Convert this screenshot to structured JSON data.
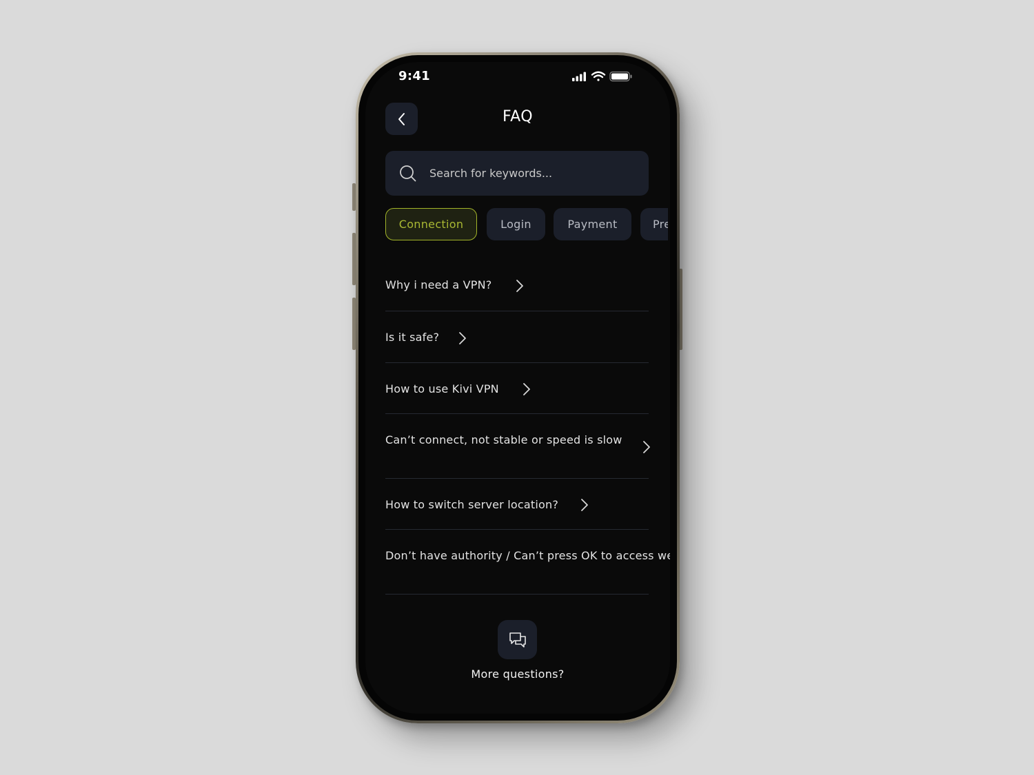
{
  "status_bar": {
    "time": "9:41",
    "icons": [
      "signal-icon",
      "wifi-icon",
      "battery-icon"
    ]
  },
  "header": {
    "title": "FAQ",
    "back_icon": "chevron-left-icon"
  },
  "search": {
    "placeholder": "Search for keywords...",
    "value": "",
    "icon": "search-icon"
  },
  "tabs": [
    {
      "label": "Connection",
      "active": true
    },
    {
      "label": "Login",
      "active": false
    },
    {
      "label": "Payment",
      "active": false
    },
    {
      "label": "Pre",
      "active": false
    }
  ],
  "faq": {
    "items": [
      {
        "question": "Why i need a VPN?"
      },
      {
        "question": "Is it safe?"
      },
      {
        "question": "How to use Kivi VPN"
      },
      {
        "question": "Can’t connect, not stable or speed is slow"
      },
      {
        "question": "How to switch server location?"
      },
      {
        "question": "Don’t have authority / Can’t press OK to access we"
      }
    ]
  },
  "footer": {
    "chat_icon": "chat-bubbles-icon",
    "more_label": "More questions?"
  },
  "colors": {
    "background": "#0a0a0a",
    "surface": "#1b1f2a",
    "accent": "#a3b52a",
    "text": "#e3e3e3"
  }
}
